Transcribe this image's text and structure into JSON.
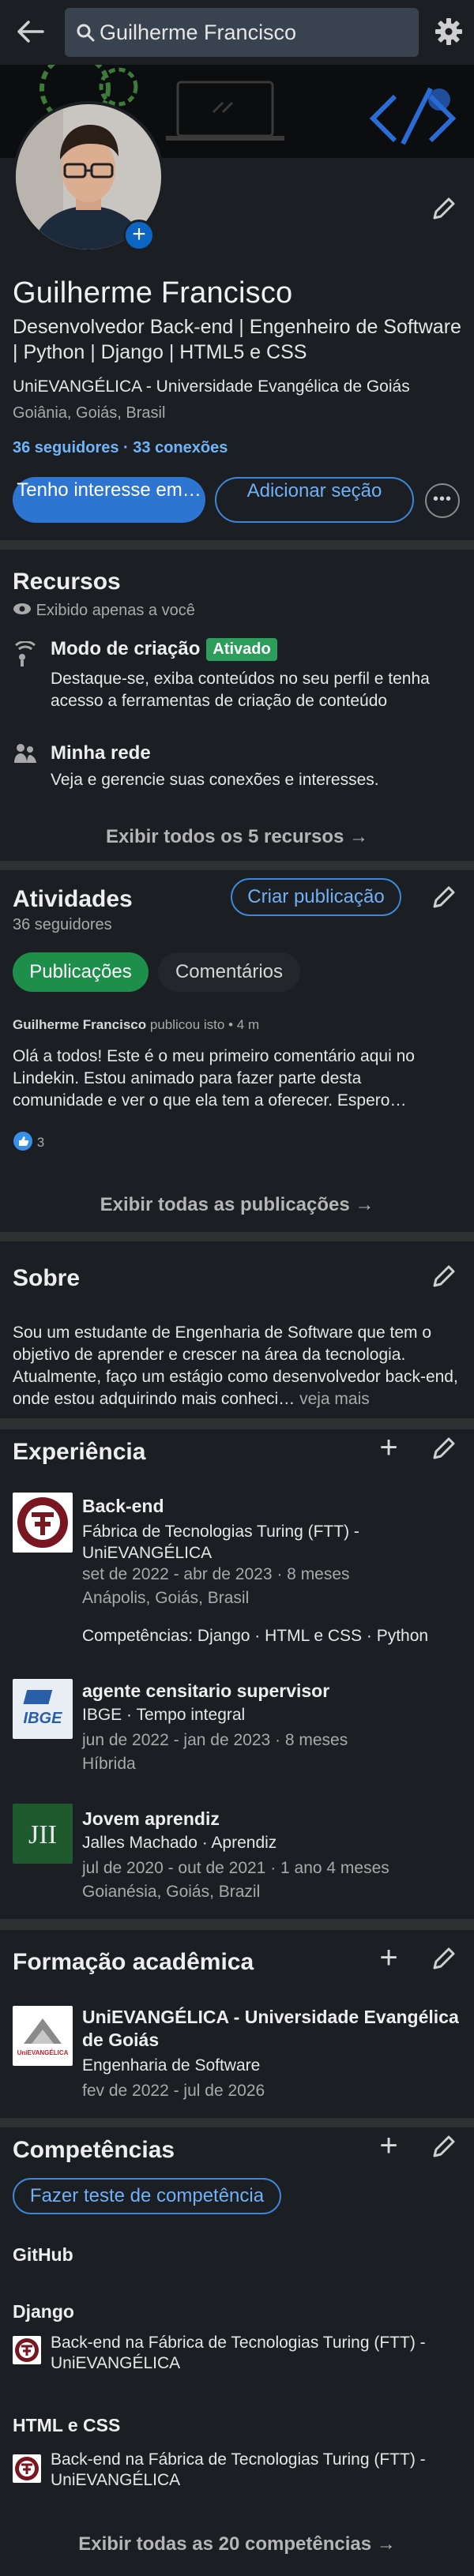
{
  "search": {
    "value": "Guilherme Francisco"
  },
  "profile": {
    "name": "Guilherme Francisco",
    "headline": "Desenvolvedor Back-end | Engenheiro de Software | Python | Django | HTML5 e CSS",
    "school": "UniEVANGÉLICA - Universidade Evangélica de Goiás",
    "location": "Goiânia, Goiás, Brasil",
    "connections": "36 seguidores · 33 conexões",
    "btn_primary": "Tenho interesse em…",
    "btn_secondary": "Adicionar seção",
    "more": "•••"
  },
  "resources": {
    "title": "Recursos",
    "visibility": "Exibido apenas a você",
    "items": [
      {
        "title": "Modo de criação",
        "badge": "Ativado",
        "desc": "Destaque-se, exiba conteúdos no seu perfil e tenha acesso a ferramentas de criação de conteúdo"
      },
      {
        "title": "Minha rede",
        "desc": "Veja e gerencie suas conexões e interesses."
      }
    ],
    "show_all": "Exibir todos os 5 recursos →"
  },
  "activity": {
    "title": "Atividades",
    "followers": "36 seguidores",
    "create_btn": "Criar publicação",
    "tabs": [
      "Publicações",
      "Comentários"
    ],
    "post_author": "Guilherme Francisco",
    "post_meta": "publicou isto • 4 m",
    "post_text": "Olá a todos! Este é o meu primeiro comentário aqui no Lindekin. Estou animado para fazer parte desta comunidade e ver o que ela tem a oferecer. Espero…",
    "reactions": "3",
    "show_all": "Exibir todas as publicações →"
  },
  "about": {
    "title": "Sobre",
    "text": "Sou um estudante de Engenharia de Software que tem o objetivo de aprender e crescer na área da tecnologia. Atualmente, faço um estágio como desenvolvedor back-end, onde estou adquirindo mais conheci…",
    "more": "veja mais"
  },
  "experience": {
    "title": "Experiência",
    "items": [
      {
        "title": "Back-end",
        "company": "Fábrica de Tecnologias Turing (FTT) - UniEVANGÉLICA",
        "dates": "set de 2022 - abr de 2023 · 8 meses",
        "place": "Anápolis, Goiás, Brasil",
        "skills": "Competências: Django · HTML e CSS · Python",
        "logo": "turing-logo"
      },
      {
        "title": "agente censitario supervisor",
        "company": "IBGE · Tempo integral",
        "dates": "jun de 2022 - jan de 2023 · 8 meses",
        "place": "Híbrida",
        "logo_text": "IBGE"
      },
      {
        "title": "Jovem aprendiz",
        "company": "Jalles Machado · Aprendiz",
        "dates": "jul de 2020 - out de 2021 · 1 ano 4 meses",
        "place": "Goianésia, Goiás, Brazil",
        "logo_text": "JII"
      }
    ]
  },
  "education": {
    "title": "Formação acadêmica",
    "school": "UniEVANGÉLICA - Universidade Evangélica de Goiás",
    "degree": "Engenharia de Software",
    "dates": "fev de 2022 - jul de 2026",
    "logo_text": "UniEVANGÉLICA"
  },
  "skills": {
    "title": "Competências",
    "test_btn": "Fazer teste de competência",
    "items": [
      {
        "name": "GitHub"
      },
      {
        "name": "Django",
        "source": "Back-end na Fábrica de Tecnologias Turing (FTT) - UniEVANGÉLICA"
      },
      {
        "name": "HTML e CSS",
        "source": "Back-end na Fábrica de Tecnologias Turing (FTT) - UniEVANGÉLICA"
      }
    ],
    "show_all": "Exibir todas as 20 competências →"
  },
  "colors": {
    "accent": "#70b5f9",
    "primary": "#2e75d1",
    "green": "#1e8f4b",
    "bg": "#1b1f23"
  }
}
